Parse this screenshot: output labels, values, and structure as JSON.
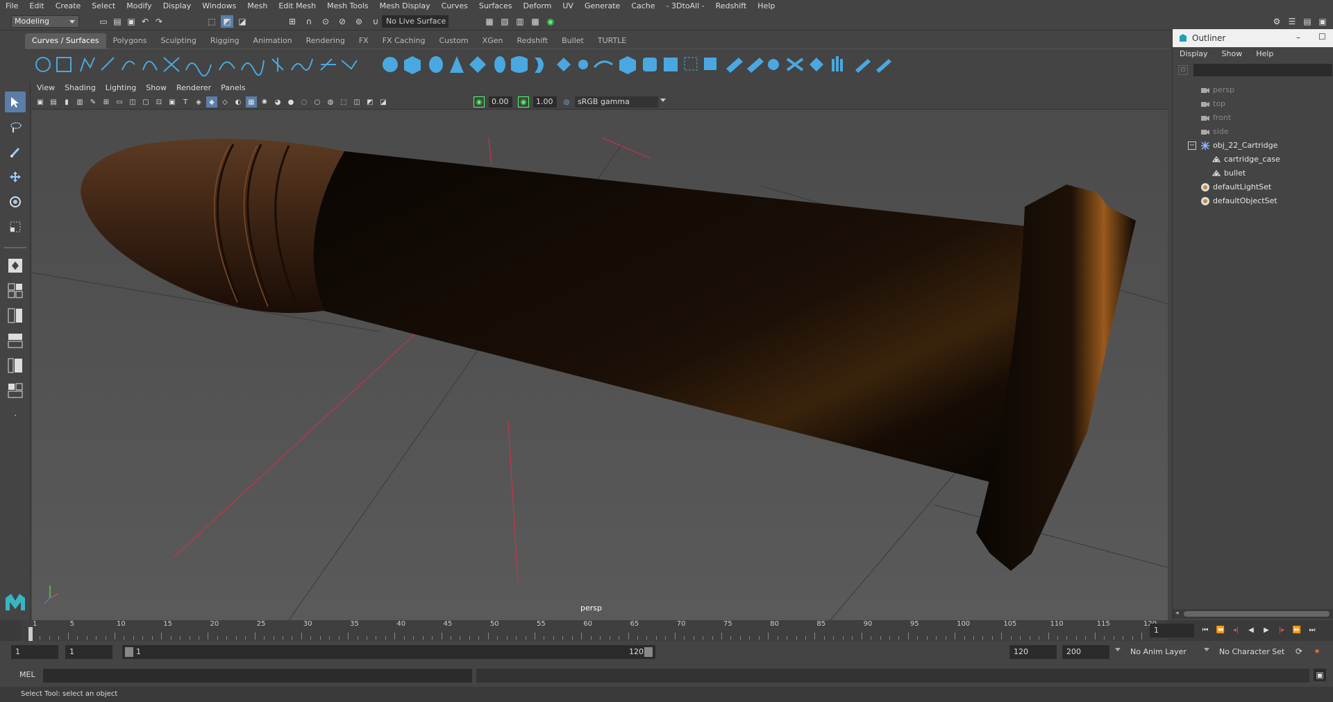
{
  "menubar": [
    "File",
    "Edit",
    "Create",
    "Select",
    "Modify",
    "Display",
    "Windows",
    "Mesh",
    "Edit Mesh",
    "Mesh Tools",
    "Mesh Display",
    "Curves",
    "Surfaces",
    "Deform",
    "UV",
    "Generate",
    "Cache",
    "- 3DtoAll -",
    "Redshift",
    "Help"
  ],
  "status": {
    "mode": "Modeling",
    "live_surface": "No Live Surface"
  },
  "shelf_tabs": [
    "Curves / Surfaces",
    "Polygons",
    "Sculpting",
    "Rigging",
    "Animation",
    "Rendering",
    "FX",
    "FX Caching",
    "Custom",
    "XGen",
    "Redshift",
    "Bullet",
    "TURTLE"
  ],
  "viewport": {
    "menu": [
      "View",
      "Shading",
      "Lighting",
      "Show",
      "Renderer",
      "Panels"
    ],
    "exposure": "0.00",
    "gamma": "1.00",
    "color_space": "sRGB gamma",
    "camera_label": "persp"
  },
  "outliner": {
    "title": "Outliner",
    "menu": [
      "Display",
      "Show",
      "Help"
    ],
    "items": [
      {
        "label": "persp",
        "type": "camera",
        "dim": true
      },
      {
        "label": "top",
        "type": "camera",
        "dim": true
      },
      {
        "label": "front",
        "type": "camera",
        "dim": true
      },
      {
        "label": "side",
        "type": "camera",
        "dim": true
      },
      {
        "label": "obj_22_Cartridge",
        "type": "group",
        "dim": false
      },
      {
        "label": "cartridge_case",
        "type": "mesh",
        "dim": false
      },
      {
        "label": "bullet",
        "type": "mesh",
        "dim": false
      },
      {
        "label": "defaultLightSet",
        "type": "set",
        "dim": false
      },
      {
        "label": "defaultObjectSet",
        "type": "set",
        "dim": false
      }
    ]
  },
  "timeline": {
    "ticks": [
      "1",
      "5",
      "10",
      "15",
      "20",
      "25",
      "30",
      "35",
      "40",
      "45",
      "50",
      "55",
      "60",
      "65",
      "70",
      "75",
      "80",
      "85",
      "90",
      "95",
      "100",
      "105",
      "110",
      "115",
      "120"
    ],
    "current_frame": "1"
  },
  "range": {
    "start": "1",
    "playback_start": "1",
    "slider_start": "1",
    "slider_end": "120",
    "playback_end": "120",
    "end": "200",
    "anim_layer": "No Anim Layer",
    "character_set": "No Character Set"
  },
  "command": {
    "language": "MEL"
  },
  "help": "Select Tool: select an object",
  "colors": {
    "accent": "#5b7ea8",
    "shelf_blue": "#4aa8e0",
    "viewport_bg": "#232323"
  }
}
